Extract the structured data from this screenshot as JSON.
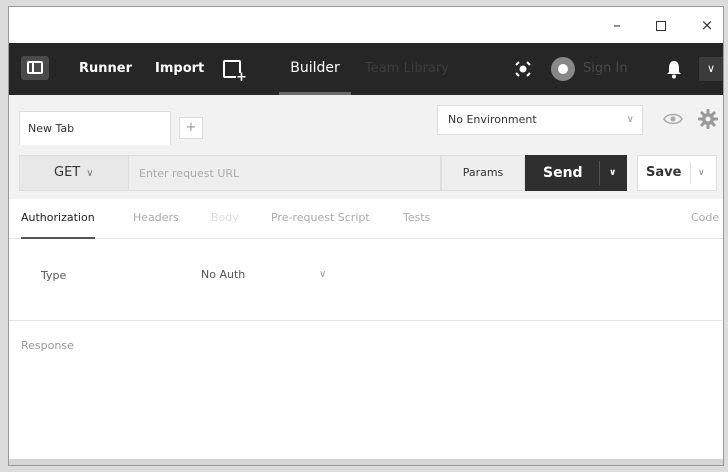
{
  "window_controls": {
    "minimize": "–",
    "maximize": "",
    "close": "×"
  },
  "toolbar": {
    "runner_label": "Runner",
    "import_label": "Import",
    "builder_tab": "Builder",
    "team_tab": "Team Library",
    "sign_in": "Sign In"
  },
  "tabs": {
    "active_tab_label": "New Tab",
    "add_tab_label": "+"
  },
  "environment": {
    "selected": "No Environment",
    "caret": "∨"
  },
  "request": {
    "method": "GET",
    "method_caret": "∨",
    "url_value": "",
    "url_placeholder": "Enter request URL",
    "params_label": "Params",
    "send_label": "Send",
    "send_caret": "∨",
    "save_label": "Save",
    "save_caret": "∨"
  },
  "subtabs": {
    "authorization": "Authorization",
    "headers": "Headers",
    "body": "Body",
    "prerequest": "Pre-request Script",
    "tests": "Tests",
    "code": "Code"
  },
  "auth": {
    "type_label": "Type",
    "type_value": "No Auth",
    "caret": "∨"
  },
  "response": {
    "label": "Response"
  },
  "colors": {
    "toolbar_bg": "#262626",
    "send_bg": "#2f2f2f",
    "panel_bg": "#f2f2f2"
  }
}
